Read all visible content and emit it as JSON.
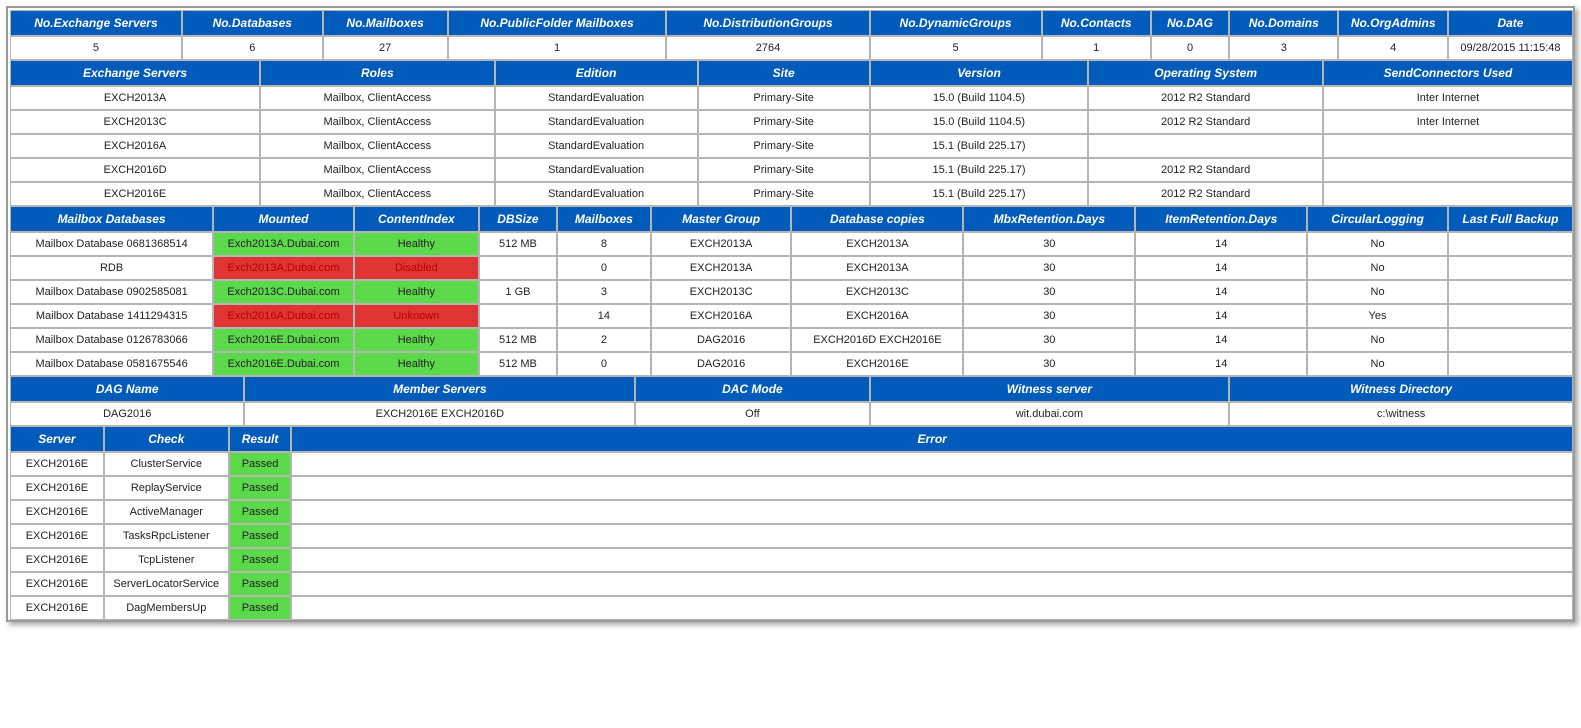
{
  "summary": {
    "headers": [
      "No.Exchange Servers",
      "No.Databases",
      "No.Mailboxes",
      "No.PublicFolder Mailboxes",
      "No.DistributionGroups",
      "No.DynamicGroups",
      "No.Contacts",
      "No.DAG",
      "No.Domains",
      "No.OrgAdmins",
      "Date"
    ],
    "values": [
      "5",
      "6",
      "27",
      "1",
      "2764",
      "5",
      "1",
      "0",
      "3",
      "4",
      "09/28/2015 11:15:48"
    ]
  },
  "servers": {
    "headers": [
      "Exchange Servers",
      "Roles",
      "Edition",
      "Site",
      "Version",
      "Operating System",
      "SendConnectors Used"
    ],
    "rows": [
      [
        "EXCH2013A",
        "Mailbox, ClientAccess",
        "StandardEvaluation",
        "Primary-Site",
        "15.0 (Build 1104.5)",
        "2012 R2 Standard",
        "Inter Internet"
      ],
      [
        "EXCH2013C",
        "Mailbox, ClientAccess",
        "StandardEvaluation",
        "Primary-Site",
        "15.0 (Build 1104.5)",
        "2012 R2 Standard",
        "Inter Internet"
      ],
      [
        "EXCH2016A",
        "Mailbox, ClientAccess",
        "StandardEvaluation",
        "Primary-Site",
        "15.1 (Build 225.17)",
        "",
        ""
      ],
      [
        "EXCH2016D",
        "Mailbox, ClientAccess",
        "StandardEvaluation",
        "Primary-Site",
        "15.1 (Build 225.17)",
        "2012 R2 Standard",
        ""
      ],
      [
        "EXCH2016E",
        "Mailbox, ClientAccess",
        "StandardEvaluation",
        "Primary-Site",
        "15.1 (Build 225.17)",
        "2012 R2 Standard",
        ""
      ]
    ]
  },
  "databases": {
    "headers": [
      "Mailbox Databases",
      "Mounted",
      "ContentIndex",
      "DBSize",
      "Mailboxes",
      "Master Group",
      "Database copies",
      "MbxRetention.Days",
      "ItemRetention.Days",
      "CircularLogging",
      "Last Full Backup"
    ],
    "rows": [
      {
        "cells": [
          "Mailbox Database 0681368514",
          "Exch2013A.Dubai.com",
          "Healthy",
          "512 MB",
          "8",
          "EXCH2013A",
          "EXCH2013A",
          "30",
          "14",
          "No",
          ""
        ],
        "mounted": "green",
        "index": "green"
      },
      {
        "cells": [
          "RDB",
          "Exch2013A.Dubai.com",
          "Disabled",
          "",
          "0",
          "EXCH2013A",
          "EXCH2013A",
          "30",
          "14",
          "No",
          ""
        ],
        "mounted": "red",
        "index": "red"
      },
      {
        "cells": [
          "Mailbox Database 0902585081",
          "Exch2013C.Dubai.com",
          "Healthy",
          "1 GB",
          "3",
          "EXCH2013C",
          "EXCH2013C",
          "30",
          "14",
          "No",
          ""
        ],
        "mounted": "green",
        "index": "green"
      },
      {
        "cells": [
          "Mailbox Database 1411294315",
          "Exch2016A.Dubai.com",
          "Unknown",
          "",
          "14",
          "EXCH2016A",
          "EXCH2016A",
          "30",
          "14",
          "Yes",
          ""
        ],
        "mounted": "red",
        "index": "red"
      },
      {
        "cells": [
          "Mailbox Database 0126783066",
          "Exch2016E.Dubai.com",
          "Healthy",
          "512 MB",
          "2",
          "DAG2016",
          "EXCH2016D EXCH2016E",
          "30",
          "14",
          "No",
          ""
        ],
        "mounted": "green",
        "index": "green"
      },
      {
        "cells": [
          "Mailbox Database 0581675546",
          "Exch2016E.Dubai.com",
          "Healthy",
          "512 MB",
          "0",
          "DAG2016",
          "EXCH2016E",
          "30",
          "14",
          "No",
          ""
        ],
        "mounted": "green",
        "index": "green"
      }
    ]
  },
  "dag": {
    "headers": [
      "DAG Name",
      "Member Servers",
      "DAC Mode",
      "Witness server",
      "Witness Directory"
    ],
    "values": [
      "DAG2016",
      "EXCH2016E EXCH2016D",
      "Off",
      "wit.dubai.com",
      "c:\\witness"
    ]
  },
  "checks": {
    "headers": [
      "Server",
      "Check",
      "Result",
      "Error"
    ],
    "rows": [
      {
        "server": "EXCH2016E",
        "check": "ClusterService",
        "result": "Passed",
        "error": ""
      },
      {
        "server": "EXCH2016E",
        "check": "ReplayService",
        "result": "Passed",
        "error": ""
      },
      {
        "server": "EXCH2016E",
        "check": "ActiveManager",
        "result": "Passed",
        "error": ""
      },
      {
        "server": "EXCH2016E",
        "check": "TasksRpcListener",
        "result": "Passed",
        "error": ""
      },
      {
        "server": "EXCH2016E",
        "check": "TcpListener",
        "result": "Passed",
        "error": ""
      },
      {
        "server": "EXCH2016E",
        "check": "ServerLocatorService",
        "result": "Passed",
        "error": ""
      },
      {
        "server": "EXCH2016E",
        "check": "DagMembersUp",
        "result": "Passed",
        "error": ""
      }
    ]
  }
}
